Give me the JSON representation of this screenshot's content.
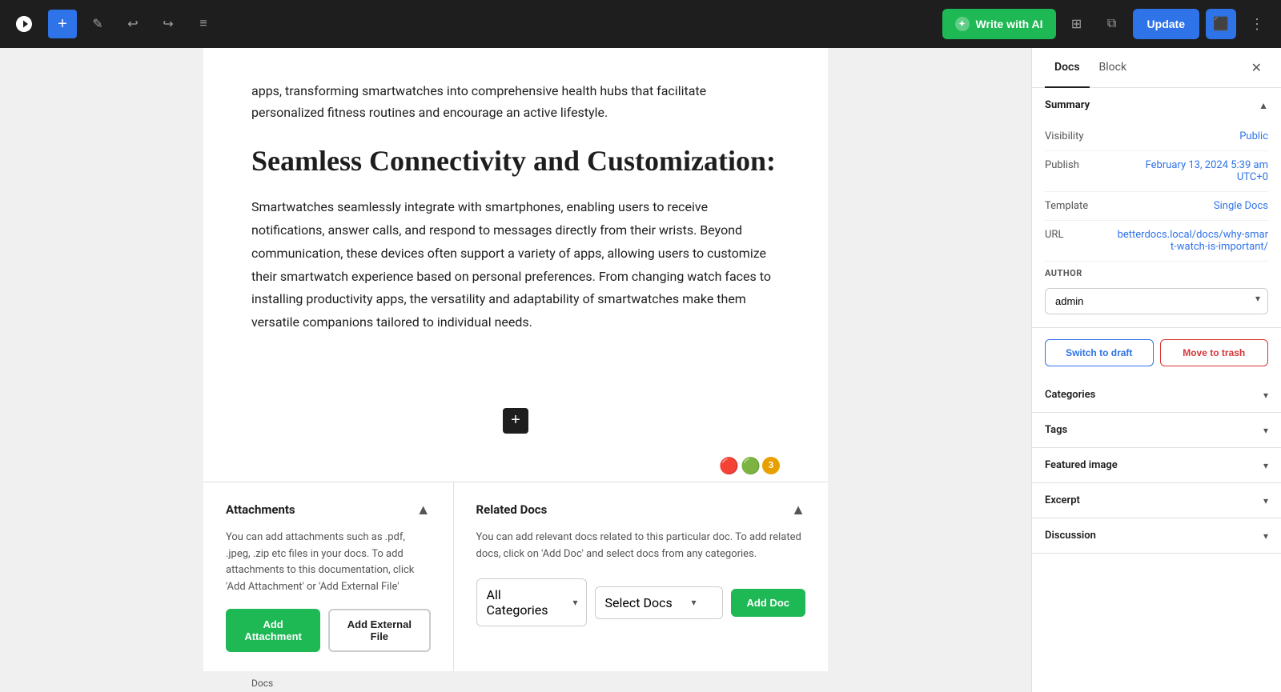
{
  "toolbar": {
    "add_label": "+",
    "edit_label": "✎",
    "undo_label": "↩",
    "redo_label": "↪",
    "list_label": "≡",
    "write_ai_label": "Write with AI",
    "view_label": "⊡",
    "external_label": "⬡",
    "update_label": "Update",
    "settings_label": "▣",
    "more_label": "⋮"
  },
  "editor": {
    "intro_text": "apps, transforming smartwatches into comprehensive health hubs that facilitate personalized fitness routines and encourage an active lifestyle.",
    "heading": "Seamless Connectivity and Customization:",
    "paragraph": "Smartwatches seamlessly integrate with smartphones, enabling users to receive notifications, answer calls, and respond to messages directly from their wrists. Beyond communication, these devices often support a variety of apps, allowing users to customize their smartwatch experience based on personal preferences. From changing watch faces to installing productivity apps, the versatility and adaptability of smartwatches make them versatile companions tailored to individual needs."
  },
  "attachments": {
    "title": "Attachments",
    "description": "You can add attachments such as .pdf, .jpeg, .zip etc files in your docs. To add attachments to this documentation, click 'Add Attachment' or 'Add External File'",
    "add_attachment_label": "Add Attachment",
    "add_external_label": "Add External File"
  },
  "related_docs": {
    "title": "Related Docs",
    "description": "You can add relevant docs related to this particular doc. To add related docs, click on 'Add Doc' and select docs from any categories.",
    "all_categories_label": "All Categories",
    "select_docs_label": "Select Docs",
    "add_doc_label": "Add Doc"
  },
  "sidebar": {
    "docs_tab": "Docs",
    "block_tab": "Block",
    "summary_section": "Summary",
    "visibility_label": "Visibility",
    "visibility_value": "Public",
    "publish_label": "Publish",
    "publish_value": "February 13, 2024 5:39 am UTC+0",
    "template_label": "Template",
    "template_value": "Single Docs",
    "url_label": "URL",
    "url_value": "betterdocs.local/docs/why-smart-watch-is-important/",
    "author_label": "AUTHOR",
    "author_value": "admin",
    "switch_draft_label": "Switch to draft",
    "move_trash_label": "Move to trash",
    "categories_label": "Categories",
    "tags_label": "Tags",
    "featured_image_label": "Featured image",
    "excerpt_label": "Excerpt",
    "discussion_label": "Discussion"
  },
  "bottom_bar": {
    "label": "Docs"
  }
}
